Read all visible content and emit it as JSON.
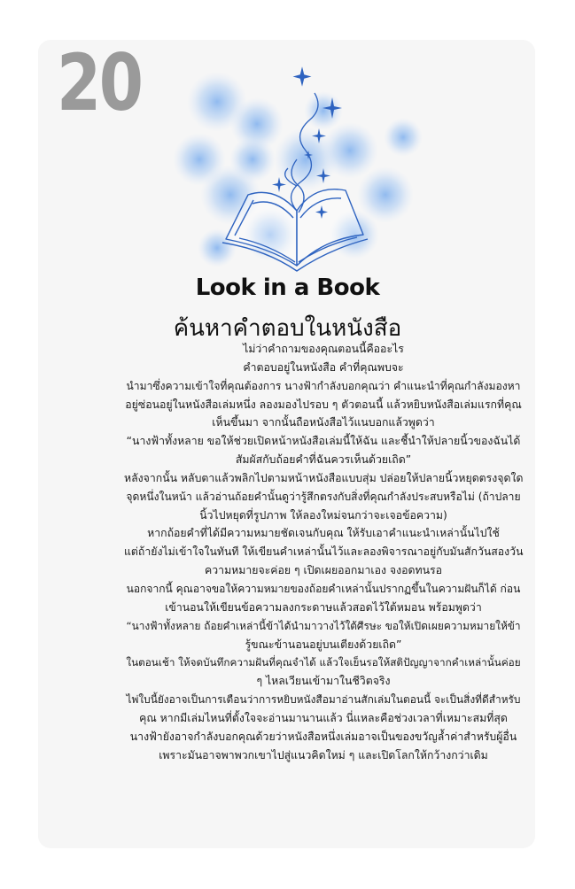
{
  "card": {
    "number": "20",
    "title_en": "Look in a Book",
    "title_th": "ค้นหาคำตอบในหนังสือ",
    "illustration_icon": "open-book-with-sparkles-icon",
    "colors": {
      "card_background": "#f6f6f6",
      "number": "#9a9a9a",
      "glow": "#8fb8ef",
      "book_line": "#2e63c0"
    },
    "body_lines": [
      "ไม่ว่าคำถามของคุณตอนนี้คืออะไร",
      "คำตอบอยู่ในหนังสือ คำที่คุณพบจะ",
      "นำมาซึ่งความเข้าใจที่คุณต้องการ นางฟ้ากำลังบอกคุณว่า คำแนะนำที่คุณกำลังมองหา",
      "อยู่ซ่อนอยู่ในหนังสือเล่มหนึ่ง ลองมองไปรอบ ๆ ตัวตอนนี้ แล้วหยิบหนังสือเล่มแรกที่คุณ",
      "เห็นขึ้นมา จากนั้นถือหนังสือไว้แนบอกแล้วพูดว่า",
      "“นางฟ้าทั้งหลาย ขอให้ช่วยเปิดหน้าหนังสือเล่มนี้ให้ฉัน และชี้นำให้ปลายนิ้วของฉันได้",
      "สัมผัสกับถ้อยคำที่ฉันควรเห็นด้วยเถิด”",
      "หลังจากนั้น หลับตาแล้วพลิกไปตามหน้าหนังสือแบบสุ่ม ปล่อยให้ปลายนิ้วหยุดตรงจุดใด",
      "จุดหนึ่งในหน้า แล้วอ่านถ้อยคำนั้นดูว่ารู้สึกตรงกับสิ่งที่คุณกำลังประสบหรือไม่ (ถ้าปลาย",
      "นิ้วไปหยุดที่รูปภาพ ให้ลองใหม่จนกว่าจะเจอข้อความ)",
      "หากถ้อยคำที่ได้มีความหมายชัดเจนกับคุณ ให้รับเอาคำแนะนำเหล่านั้นไปใช้",
      "แต่ถ้ายังไม่เข้าใจในทันที ให้เขียนคำเหล่านั้นไว้และลองพิจารณาอยู่กับมันสักวันสองวัน",
      "ความหมายจะค่อย ๆ เปิดเผยออกมาเอง จงอดทนรอ",
      "นอกจากนี้ คุณอาจขอให้ความหมายของถ้อยคำเหล่านั้นปรากฏขึ้นในความฝันก็ได้ ก่อน",
      "เข้านอนให้เขียนข้อความลงกระดาษแล้วสอดไว้ใต้หมอน พร้อมพูดว่า",
      "“นางฟ้าทั้งหลาย ถ้อยคำเหล่านี้ข้าได้นำมาวางไว้ใต้ศีรษะ ขอให้เปิดเผยความหมายให้ข้า",
      "รู้ขณะข้านอนอยู่บนเตียงด้วยเถิด”",
      "ในตอนเช้า ให้จดบันทึกความฝันที่คุณจำได้ แล้วใจเย็นรอให้สติปัญญาจากคำเหล่านั้นค่อย",
      "ๆ ไหลเวียนเข้ามาในชีวิตจริง",
      "ไพ่ใบนี้ยังอาจเป็นการเตือนว่าการหยิบหนังสือมาอ่านสักเล่มในตอนนี้ จะเป็นสิ่งที่ดีสำหรับ",
      "คุณ หากมีเล่มไหนที่ตั้งใจจะอ่านมานานแล้ว นี่แหละคือช่วงเวลาที่เหมาะสมที่สุด",
      "นางฟ้ายังอาจกำลังบอกคุณด้วยว่าหนังสือหนึ่งเล่มอาจเป็นของขวัญล้ำค่าสำหรับผู้อื่น",
      "เพราะมันอาจพาพวกเขาไปสู่แนวคิดใหม่ ๆ และเปิดโลกให้กว้างกว่าเดิม"
    ]
  }
}
